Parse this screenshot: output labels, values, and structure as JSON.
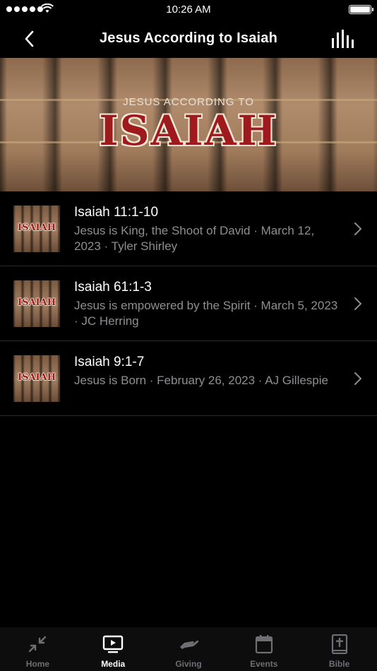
{
  "status_bar": {
    "time": "10:26 AM"
  },
  "nav": {
    "title": "Jesus According to Isaiah"
  },
  "banner": {
    "subtitle": "JESUS ACCORDING TO",
    "title": "ISAIAH"
  },
  "items": [
    {
      "title": "Isaiah 11:1-10",
      "subtitle": "Jesus is King, the Shoot of David · March 12, 2023 · Tyler Shirley",
      "thumb_title": "ISAIAH"
    },
    {
      "title": "Isaiah 61:1-3",
      "subtitle": "Jesus is empowered by the Spirit · March 5, 2023 · JC Herring",
      "thumb_title": "ISAIAH"
    },
    {
      "title": "Isaiah 9:1-7",
      "subtitle": "Jesus is Born · February 26, 2023 · AJ Gillespie",
      "thumb_title": "ISAIAH"
    }
  ],
  "tabs": [
    {
      "label": "Home",
      "icon": "collapse-arrows-icon",
      "active": false
    },
    {
      "label": "Media",
      "icon": "tv-play-icon",
      "active": true
    },
    {
      "label": "Giving",
      "icon": "hand-icon",
      "active": false
    },
    {
      "label": "Events",
      "icon": "calendar-icon",
      "active": false
    },
    {
      "label": "Bible",
      "icon": "bible-icon",
      "active": false
    }
  ],
  "colors": {
    "background": "#000000",
    "inactive_tab": "#6e6e73",
    "secondary_text": "#8e8e93",
    "banner_title": "#9e1a1d"
  }
}
